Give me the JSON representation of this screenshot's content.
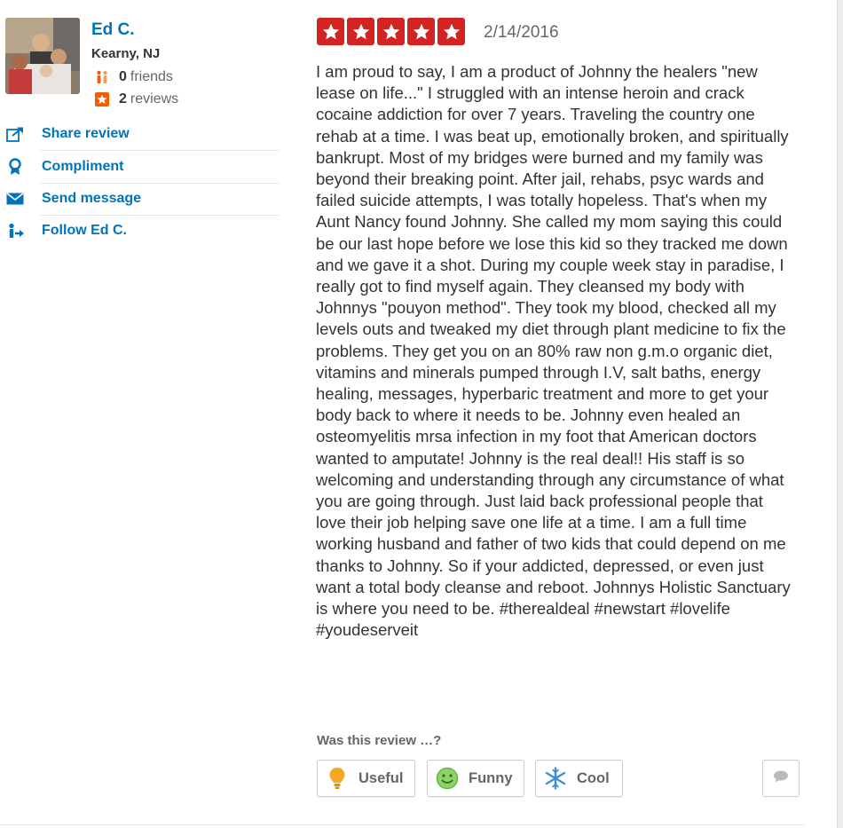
{
  "user": {
    "name": "Ed C.",
    "location": "Kearny, NJ",
    "friends_count": "0",
    "friends_label": "friends",
    "reviews_count": "2",
    "reviews_label": "reviews",
    "avatar_icon": "user-photo"
  },
  "actions": [
    {
      "label": "Share review",
      "icon": "share-icon"
    },
    {
      "label": "Compliment",
      "icon": "compliment-icon"
    },
    {
      "label": "Send message",
      "icon": "envelope-icon"
    },
    {
      "label": "Follow Ed C.",
      "icon": "follow-icon"
    }
  ],
  "review": {
    "rating": 5,
    "rating_max": 5,
    "date": "2/14/2016",
    "text": "I am proud to say, I am a product of Johnny the healers \"new lease on life...\"  I struggled with an intense heroin and crack cocaine addiction for over 7 years.  Traveling the country one rehab at a time.  I was beat up, emotionally broken, and spiritually bankrupt.  Most of my bridges were burned and my family was beyond their breaking point.  After jail, rehabs, psyc wards and failed suicide attempts, I was totally hopeless.  That's when my Aunt Nancy found Johnny.  She called my mom saying this could be our last hope before we lose this kid so they tracked me down and we gave it a shot. During my couple week stay in paradise, I really got to find myself again.  They cleansed my body with Johnnys \"pouyon method\". They took my blood, checked all my levels outs and tweaked my diet through plant medicine to fix the problems. They get you on an 80% raw non g.m.o organic diet, vitamins and minerals pumped through I.V, salt baths, energy healing, messages, hyperbaric treatment and more to  get your body back to where it needs to be.  Johnny even healed an osteomyelitis mrsa infection in my foot that American doctors wanted to amputate!  Johnny is the real deal!!  His staff is so welcoming and understanding through any circumstance of what you are going through.  Just laid back professional people that love their job helping save one life at a time.  I am a full time working husband and father of two kids that could depend on me thanks to Johnny. So if your addicted, depressed, or even just want a total body cleanse and reboot. Johnnys Holistic Sanctuary is where you need to be. #therealdeal #newstart #lovelife #youdeserveit"
  },
  "feedback": {
    "question": "Was this review …?",
    "useful_label": "Useful",
    "funny_label": "Funny",
    "cool_label": "Cool"
  },
  "colors": {
    "link_blue": "#0073bb",
    "star_red": "#d32323",
    "friends_orange": "#f15c00"
  }
}
